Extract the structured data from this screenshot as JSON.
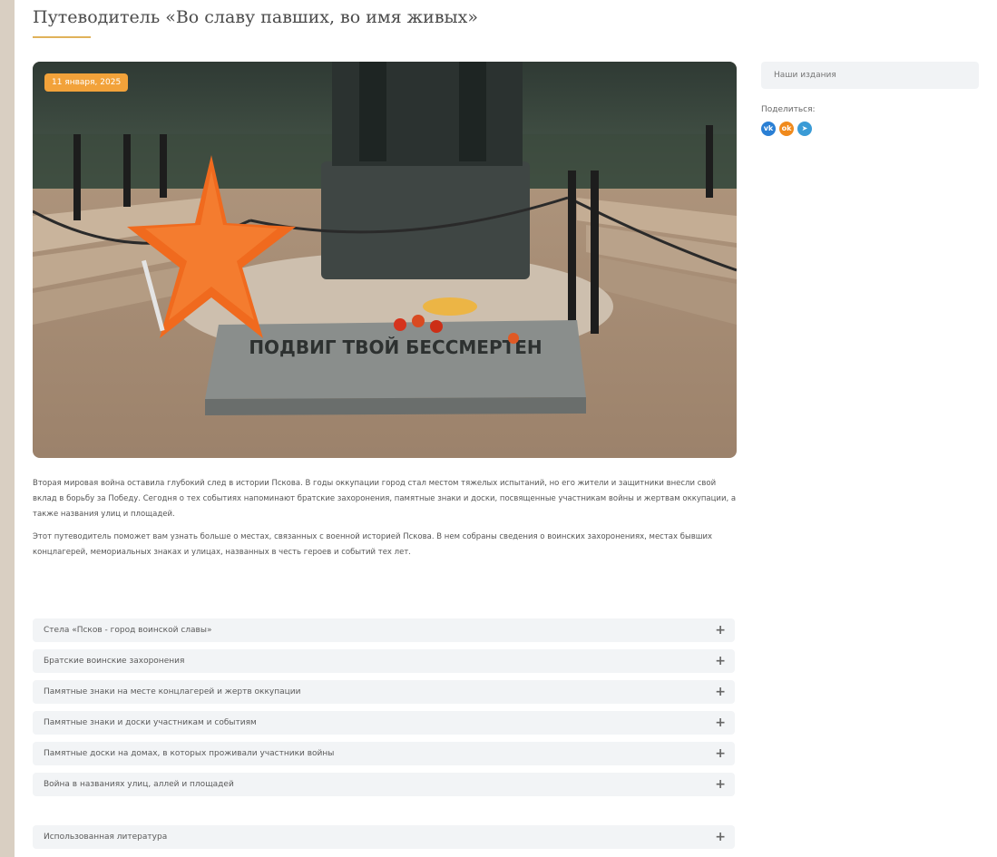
{
  "page": {
    "title": "Путеводитель «Во славу павших, во имя живых»",
    "date_badge": "11 января, 2025"
  },
  "content": {
    "paragraphs": [
      "Вторая мировая война оставила глубокий след в истории Пскова. В годы оккупации город стал местом тяжелых испытаний, но его жители и защитники внесли свой вклад в борьбу за Победу. Сегодня о тех событиях напоминают братские захоронения, памятные знаки и доски, посвященные участникам войны и жертвам оккупации, а также названия улиц и площадей.",
      "Этот путеводитель поможет вам узнать больше о местах, связанных с военной историей Пскова. В нем собраны сведения о воинских захоронениях, местах бывших концлагерей, мемориальных знаках и улицах, названных в честь героев и событий тех лет."
    ]
  },
  "accordion": {
    "items": [
      "Стела «Псков - город воинской славы»",
      "Братские воинские захоронения",
      "Памятные знаки на месте концлагерей и жертв оккупации",
      "Памятные знаки и доски участникам и событиям",
      "Памятные доски на домах, в которых проживали участники войны",
      "Война в названиях улиц, аллей и площадей"
    ],
    "literature": "Использованная литература",
    "toggle_glyph": "+"
  },
  "sidebar": {
    "search_placeholder": "Наши издания",
    "share_label": "Поделиться:",
    "share_icons": [
      {
        "name": "vk-icon",
        "glyph": "vk",
        "color": "#2a7fd4"
      },
      {
        "name": "ok-icon",
        "glyph": "ok",
        "color": "#f08a1c"
      },
      {
        "name": "telegram-icon",
        "glyph": "➤",
        "color": "#3a9bd6"
      }
    ]
  },
  "hero": {
    "plaque_text": "ПОДВИГ ТВОЙ БЕССМЕРТЕН"
  }
}
